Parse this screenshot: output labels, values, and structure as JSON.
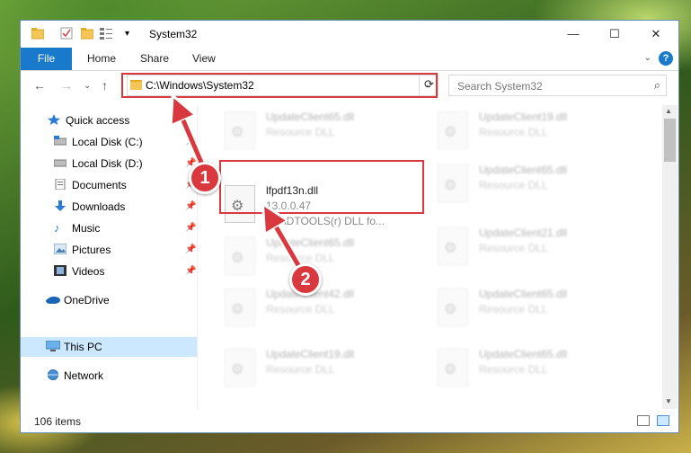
{
  "window": {
    "title": "System32",
    "minimize_glyph": "—",
    "maximize_glyph": "☐",
    "close_glyph": "✕"
  },
  "ribbon": {
    "file_label": "File",
    "tabs": [
      "Home",
      "Share",
      "View"
    ],
    "help_glyph": "?"
  },
  "address": {
    "path": "C:\\Windows\\System32",
    "search_placeholder": "Search System32"
  },
  "nav": {
    "items": [
      {
        "label": "Quick access",
        "icon": "star-icon",
        "pinned": false
      },
      {
        "label": "Local Disk (C:)",
        "icon": "drive-icon",
        "pinned": true
      },
      {
        "label": "Local Disk (D:)",
        "icon": "drive-icon",
        "pinned": true
      },
      {
        "label": "Documents",
        "icon": "documents-icon",
        "pinned": true
      },
      {
        "label": "Downloads",
        "icon": "download-arrow-icon",
        "pinned": true
      },
      {
        "label": "Music",
        "icon": "music-note-icon",
        "pinned": true
      },
      {
        "label": "Pictures",
        "icon": "pictures-icon",
        "pinned": true
      },
      {
        "label": "Videos",
        "icon": "videos-icon",
        "pinned": true
      },
      {
        "label": "OneDrive",
        "icon": "cloud-icon",
        "pinned": false
      },
      {
        "label": "This PC",
        "icon": "computer-icon",
        "pinned": false
      },
      {
        "label": "Network",
        "icon": "network-icon",
        "pinned": false
      }
    ]
  },
  "files": {
    "focused": {
      "name": "lfpdf13n.dll",
      "version": "13.0.0.47",
      "description": "LEADTOOLS(r) DLL fo..."
    },
    "background": [
      {
        "name": "UpdateClient65.dll",
        "type": "Resource DLL"
      },
      {
        "name": "UpdateClient19.dll",
        "type": "Resource DLL"
      },
      {
        "name": "UpdateClient65.dll",
        "type": "Resource DLL"
      },
      {
        "name": "UpdateClient65.dll",
        "type": "Resource DLL"
      },
      {
        "name": "UpdateClient21.dll",
        "type": "Resource DLL"
      },
      {
        "name": "UpdateClient42.dll",
        "type": "Resource DLL"
      },
      {
        "name": "UpdateClient65.dll",
        "type": "Resource DLL"
      },
      {
        "name": "UpdateClient19.dll",
        "type": "Resource DLL"
      },
      {
        "name": "UpdateClient65.dll",
        "type": "Resource DLL"
      }
    ]
  },
  "status": {
    "item_count": "106 items"
  },
  "callouts": {
    "one": "1",
    "two": "2"
  },
  "colors": {
    "highlight": "#d9383e",
    "accent": "#1979ca",
    "selection": "#cce8ff"
  }
}
